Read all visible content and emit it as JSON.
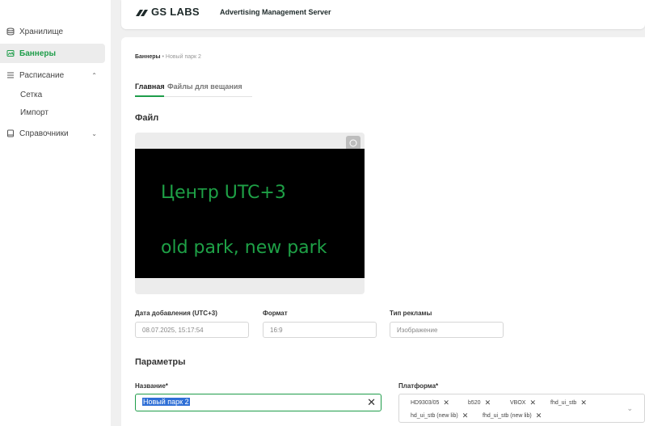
{
  "sidebar": {
    "items": [
      {
        "label": "Хранилище",
        "icon": "storage-icon"
      },
      {
        "label": "Баннеры",
        "icon": "banners-icon",
        "active": true
      },
      {
        "label": "Расписание",
        "icon": "list-icon"
      },
      {
        "label": "Справочники",
        "icon": "book-icon"
      }
    ],
    "schedule_sub": [
      "Сетка",
      "Импорт"
    ]
  },
  "header": {
    "logo": "GS LABS",
    "title": "Advertising Management Server"
  },
  "breadcrumb": {
    "root": "Баннеры",
    "separator": "•",
    "current": "Новый парк 2"
  },
  "tabs": [
    {
      "label": "Главная",
      "active": true
    },
    {
      "label": "Файлы для вещания",
      "active": false
    }
  ],
  "file_section": {
    "title": "Файл",
    "preview_line1": "Центр UTC+3",
    "preview_line2": "old park, new park"
  },
  "fields": {
    "date_label": "Дата добавления (UTC+3)",
    "date_value": "08.07.2025, 15:17:54",
    "format_label": "Формат",
    "format_value": "16:9",
    "type_label": "Тип рекламы",
    "type_value": "Изображение"
  },
  "params": {
    "title": "Параметры",
    "name_label": "Название*",
    "name_value": "Новый парк 2",
    "platform_label": "Платформа*",
    "platforms": [
      "HD9303/05",
      "b520",
      "VBOX",
      "fhd_ui_stb",
      "hd_ui_stb (new lib)",
      "fhd_ui_stb (new lib)"
    ]
  },
  "colors": {
    "accent": "#1f9d4a",
    "preview_text": "#1ea046"
  }
}
